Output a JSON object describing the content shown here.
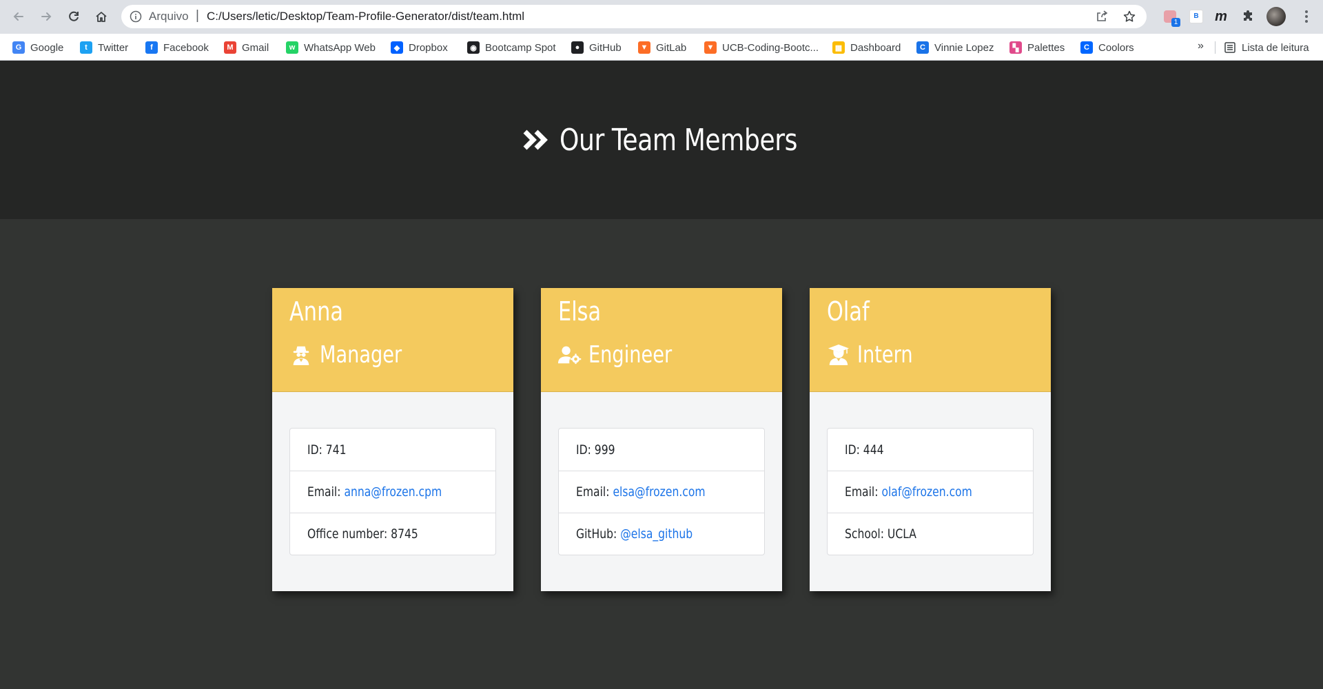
{
  "browser": {
    "url_scheme": "Arquivo",
    "url_separator": "|",
    "url_path": "C:/Users/letic/Desktop/Team-Profile-Generator/dist/team.html",
    "bookmarks": [
      {
        "label": "Google",
        "icon": "google-icon",
        "color": "#4285f4"
      },
      {
        "label": "Twitter",
        "icon": "twitter-icon",
        "color": "#1da1f2"
      },
      {
        "label": "Facebook",
        "icon": "facebook-icon",
        "color": "#1877f2"
      },
      {
        "label": "Gmail",
        "icon": "gmail-icon",
        "color": "#ea4335"
      },
      {
        "label": "WhatsApp Web",
        "icon": "whatsapp-icon",
        "color": "#25d366"
      },
      {
        "label": "Dropbox",
        "icon": "dropbox-icon",
        "color": "#0061ff"
      },
      {
        "label": "Bootcamp Spot",
        "icon": "bootcamp-icon",
        "color": "#202124"
      },
      {
        "label": "GitHub",
        "icon": "github-icon",
        "color": "#202124"
      },
      {
        "label": "GitLab",
        "icon": "gitlab-icon",
        "color": "#fc6d26"
      },
      {
        "label": "UCB-Coding-Bootc...",
        "icon": "gitlab-icon",
        "color": "#fc6d26"
      },
      {
        "label": "Dashboard",
        "icon": "dashboard-icon",
        "color": "#fbbc04"
      },
      {
        "label": "Vinnie Lopez",
        "icon": "vinnie-icon",
        "color": "#1a73e8"
      },
      {
        "label": "Palettes",
        "icon": "palettes-icon",
        "color": "#e04a8b"
      },
      {
        "label": "Coolors",
        "icon": "coolors-icon",
        "color": "#0066ff"
      }
    ],
    "bookmarks_more": "»",
    "reading_list": "Lista de leitura"
  },
  "page": {
    "title": "Our Team Members",
    "title_icon": "double-chevron-right-icon"
  },
  "team": [
    {
      "name": "Anna",
      "role": "Manager",
      "role_icon": "user-secret-icon",
      "id_label": "ID:",
      "id_value": "741",
      "email_label": "Email:",
      "email": "anna@frozen.cpm",
      "extra_label": "Office number:",
      "extra_value": "8745",
      "extra_is_link": false
    },
    {
      "name": "Elsa",
      "role": "Engineer",
      "role_icon": "user-cog-icon",
      "id_label": "ID:",
      "id_value": "999",
      "email_label": "Email:",
      "email": "elsa@frozen.com",
      "extra_label": "GitHub:",
      "extra_value": "@elsa_github",
      "extra_is_link": true
    },
    {
      "name": "Olaf",
      "role": "Intern",
      "role_icon": "user-graduate-icon",
      "id_label": "ID:",
      "id_value": "444",
      "email_label": "Email:",
      "email": "olaf@frozen.com",
      "extra_label": "School:",
      "extra_value": "UCLA",
      "extra_is_link": false
    }
  ],
  "colors": {
    "header_bg": "#252625",
    "page_bg": "#323432",
    "card_header": "#f4ca5e",
    "link": "#1a73e8"
  }
}
